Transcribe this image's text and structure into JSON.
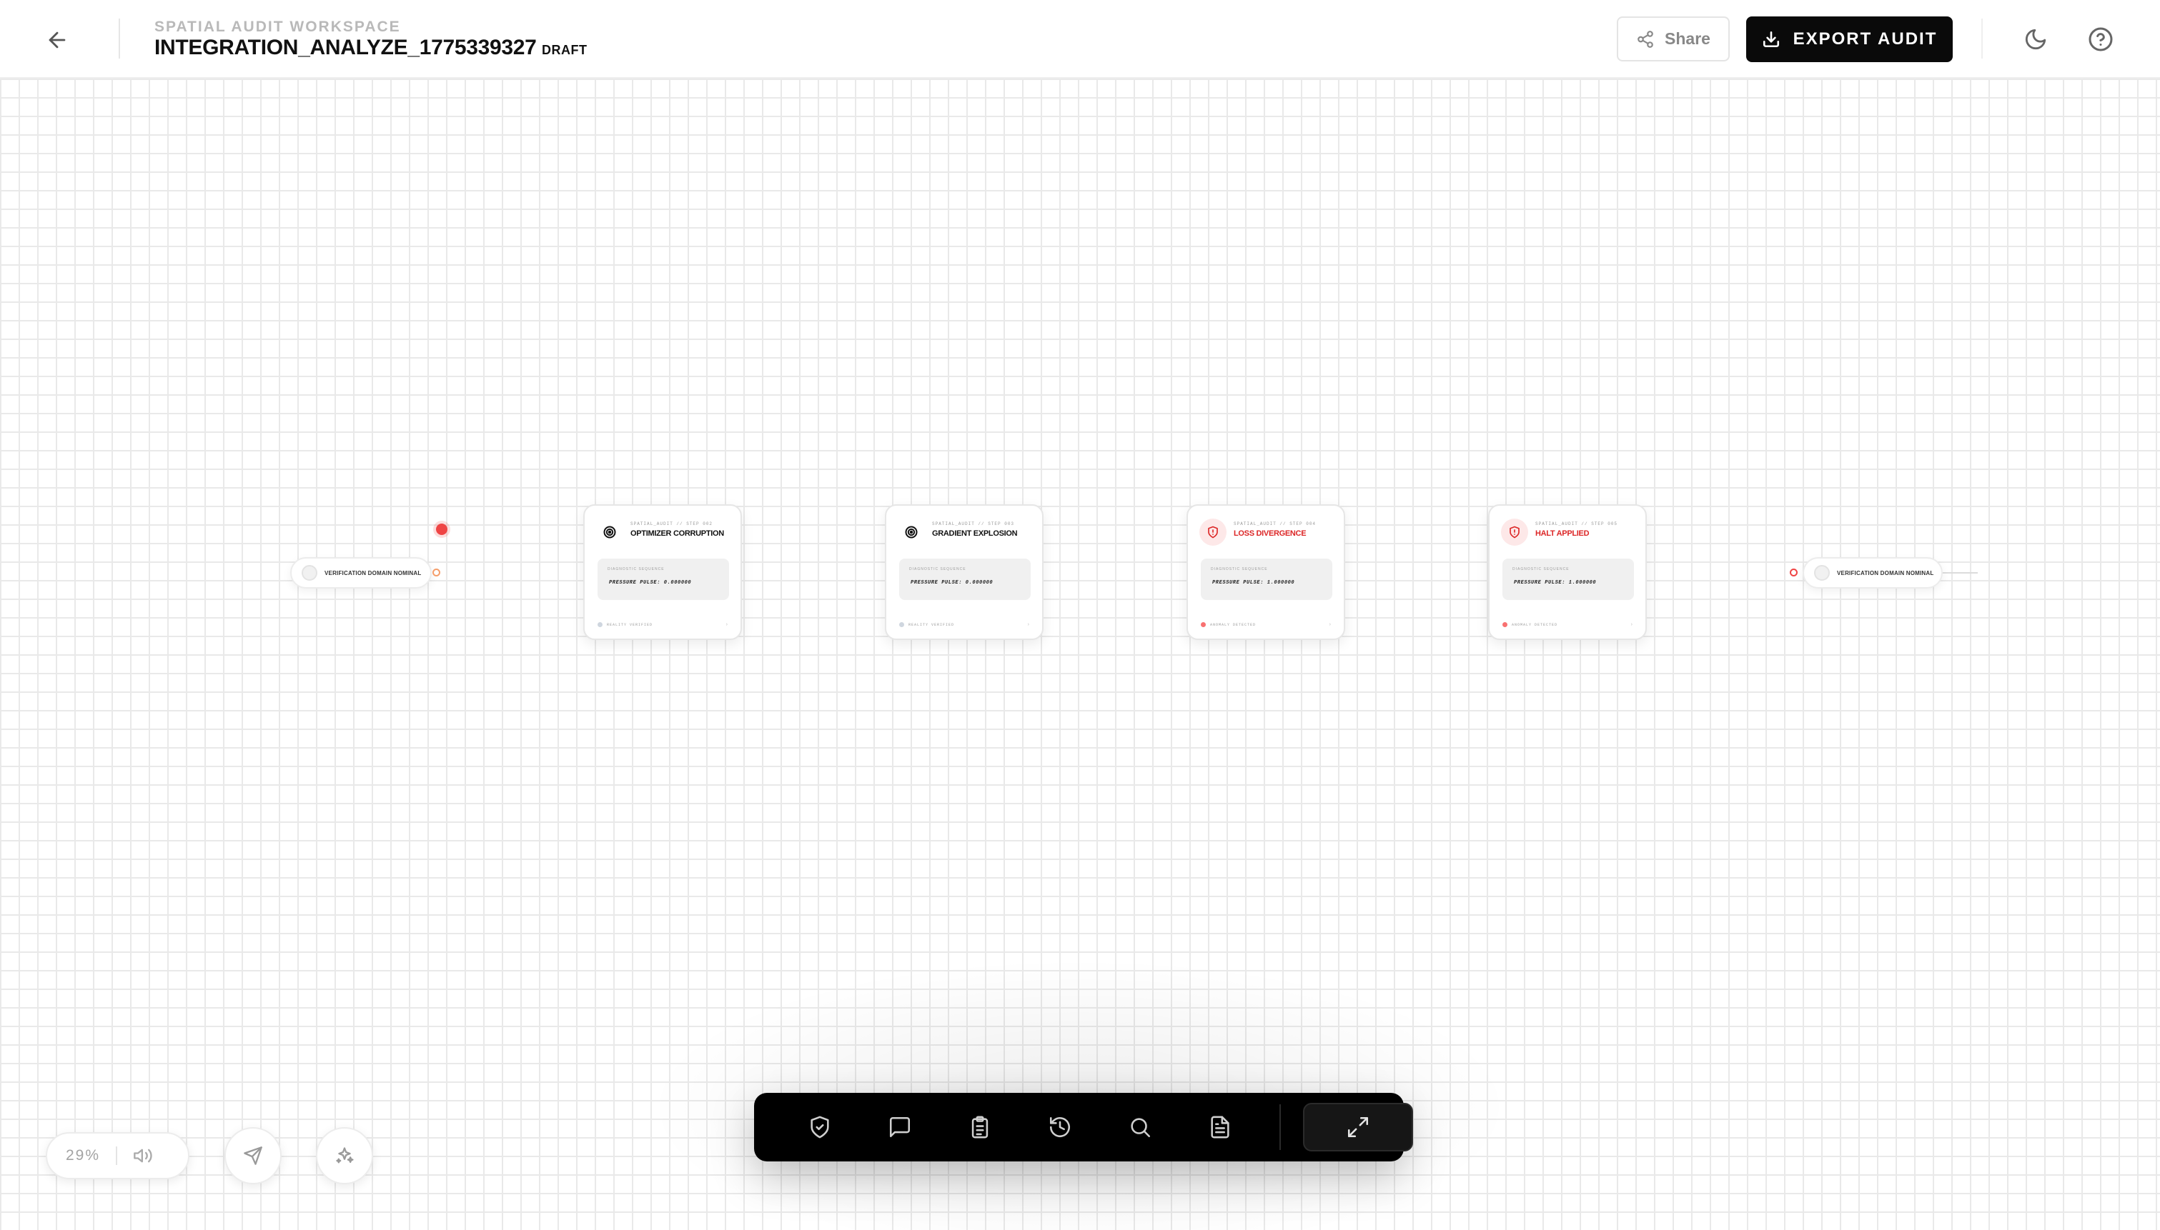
{
  "header": {
    "workspace_label": "SPATIAL AUDIT WORKSPACE",
    "title": "INTEGRATION_ANALYZE_1775339327",
    "status": "DRAFT",
    "share_label": "Share",
    "export_label": "EXPORT AUDIT"
  },
  "canvas": {
    "start_node": {
      "label": "VERIFICATION DOMAIN NOMINAL"
    },
    "end_node": {
      "label": "VERIFICATION DOMAIN NOMINAL"
    },
    "nodes": [
      {
        "meta": "SPATIAL_AUDIT // STEP 002",
        "title": "OPTIMIZER CORRUPTION",
        "inner_label": "DIAGNOSTIC SEQUENCE",
        "inner_value": "PRESSURE PULSE: 0.000000",
        "footer": "REALITY VERIFIED",
        "state": "ok",
        "icon": "target-icon"
      },
      {
        "meta": "SPATIAL_AUDIT // STEP 003",
        "title": "GRADIENT EXPLOSION",
        "inner_label": "DIAGNOSTIC SEQUENCE",
        "inner_value": "PRESSURE PULSE: 0.000000",
        "footer": "REALITY VERIFIED",
        "state": "ok",
        "icon": "target-icon"
      },
      {
        "meta": "SPATIAL_AUDIT // STEP 004",
        "title": "LOSS DIVERGENCE",
        "inner_label": "DIAGNOSTIC SEQUENCE",
        "inner_value": "PRESSURE PULSE: 1.000000",
        "footer": "ANOMALY DETECTED",
        "state": "alert",
        "icon": "shield-alert-icon"
      },
      {
        "meta": "SPATIAL_AUDIT // STEP 005",
        "title": "HALT APPLIED",
        "inner_label": "DIAGNOSTIC SEQUENCE",
        "inner_value": "PRESSURE PULSE: 1.000000",
        "footer": "ANOMALY DETECTED",
        "state": "alert",
        "icon": "shield-alert-icon"
      }
    ]
  },
  "controls": {
    "zoom": "29%",
    "icons": [
      "volume-icon",
      "navigate-icon",
      "sparkle-icon"
    ]
  },
  "dock": {
    "items": [
      "shield-check-icon",
      "comment-icon",
      "clipboard-icon",
      "history-icon",
      "search-icon",
      "document-icon",
      "expand-icon"
    ]
  },
  "colors": {
    "accent": "#000000",
    "alert": "#dc2626",
    "ok": "#9ca3af",
    "grid": "#e9e9e9"
  }
}
